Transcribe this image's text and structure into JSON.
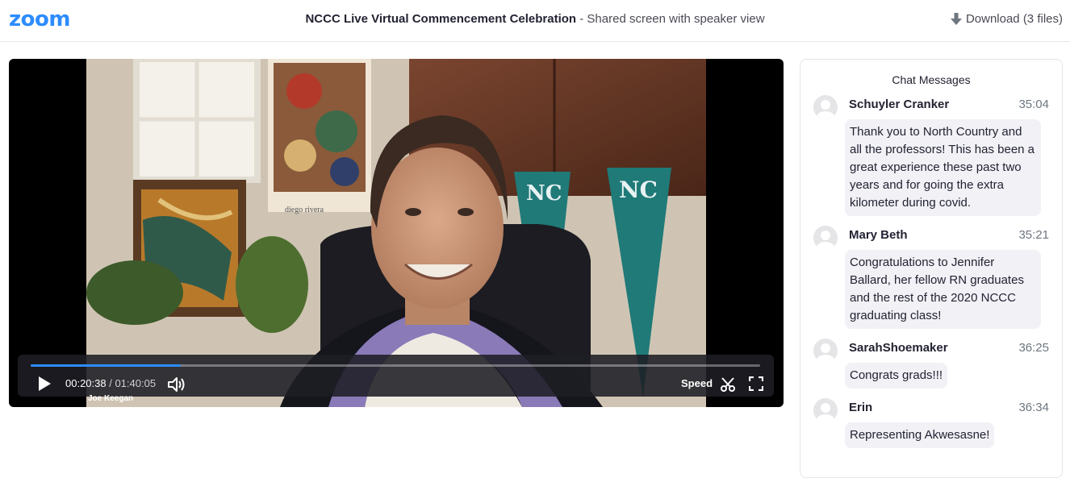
{
  "header": {
    "logo": "zoom",
    "title": "NCCC Live Virtual Commencement Celebration",
    "subtitle": " - Shared screen with speaker view",
    "download_label": "Download (3 files)",
    "download_icon": "download-arrow-icon"
  },
  "player": {
    "current_time": "00:20:38",
    "separator": " / ",
    "total_time": "01:40:05",
    "progress_fraction": 0.206,
    "speed_label": "Speed",
    "speaker_name": "Joe Keegan",
    "icons": [
      "play-icon",
      "volume-icon",
      "scissors-icon",
      "fullscreen-icon"
    ]
  },
  "chat": {
    "header": "Chat Messages",
    "messages": [
      {
        "name": "Schuyler Cranker",
        "time": "35:04",
        "text": "Thank you to North Country and all the professors! This has been a great experience these past two years and for going the extra kilometer during covid."
      },
      {
        "name": "Mary Beth",
        "time": "35:21",
        "text": "Congratulations to Jennifer Ballard, her fellow RN graduates and the rest of the 2020 NCCC graduating class!"
      },
      {
        "name": "SarahShoemaker",
        "time": "36:25",
        "text": "Congrats grads!!!"
      },
      {
        "name": "Erin",
        "time": "36:34",
        "text": "Representing Akwesasne!"
      }
    ]
  },
  "colors": {
    "brand": "#2d8cff",
    "chat_bubble": "#f1f1f6",
    "pennant": "#1f7a78"
  }
}
